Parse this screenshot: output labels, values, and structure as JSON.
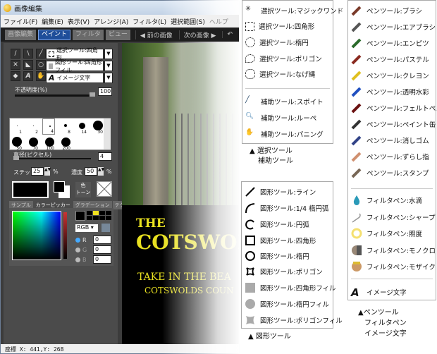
{
  "window": {
    "title": "画像編集"
  },
  "menu": [
    "ファイル(F)",
    "編集(E)",
    "表示(V)",
    "アレンジ(A)",
    "フィルタ(L)",
    "選択範囲(S)",
    "ヘルプ"
  ],
  "toolbar": {
    "tabs": [
      "画像編集",
      "ペイント",
      "フィルタ",
      "ビュー"
    ],
    "active": "ペイント",
    "prev": "◀ 前の画像",
    "next": "次の画像 ▶"
  },
  "panel": {
    "tool_selects": [
      "選択ツール:四角形",
      "図形ツール:四角形フィル",
      "イメージ文字"
    ],
    "opacity_label": "不透明度(%)",
    "opacity_value": "100",
    "opacity_fraction": 1.0,
    "brush_sizes": [
      "1",
      "2",
      "4",
      "8",
      "14",
      "30",
      "50",
      "70",
      "100",
      "200"
    ],
    "diameter_label": "直径(ピクセル)",
    "diameter_value": "4",
    "step_label": "ステップ",
    "step_value": "25",
    "density_label": "濃度",
    "density_value": "50",
    "pct": "%",
    "tone_button": "色\nトーン",
    "tabs": [
      "サンプル",
      "カラーピッカー",
      "グラデーション",
      "テクスチャ"
    ],
    "active_tab": "カラーピッカー",
    "color_mode": "RGB",
    "channels": [
      {
        "label": "R",
        "value": "0"
      },
      {
        "label": "G",
        "value": "0"
      },
      {
        "label": "B",
        "value": "0"
      }
    ]
  },
  "canvas": {
    "line1": "THE",
    "line2": "COTSWOLDS",
    "line3": "TAKE IN THE BEA",
    "line4": "COTSWOLDS COUN"
  },
  "status": "座標 X: 441,Y: 268",
  "select_menu": {
    "items": [
      "選択ツール:マジックワンド",
      "選択ツール:四角形",
      "選択ツール:楕円",
      "選択ツール:ポリゴン",
      "選択ツール:なげ縄",
      "補助ツール:スポイト",
      "補助ツール:ルーペ",
      "補助ツール:パニング"
    ],
    "caption1": "▲ 選択ツール",
    "caption2": "補助ツール"
  },
  "shape_menu": {
    "items": [
      "図形ツール:ライン",
      "図形ツール:1/4 楕円弧",
      "図形ツール:円弧",
      "図形ツール:四角形",
      "図形ツール:楕円",
      "図形ツール:ポリゴン",
      "図形ツール:四角形フィル",
      "図形ツール:楕円フィル",
      "図形ツール:ポリゴンフィル"
    ],
    "caption": "▲ 図形ツール"
  },
  "pen_menu": {
    "pens": [
      "ペンツール:ブラシ",
      "ペンツール:エアブラシ",
      "ペンツール:エンピツ",
      "ペンツール:パステル",
      "ペンツール:クレヨン",
      "ペンツール:透明水彩",
      "ペンツール:フェルトペン",
      "ペンツール:ペイント缶",
      "ペンツール:消しゴム",
      "ペンツール:ずらし指",
      "ペンツール:スタンプ"
    ],
    "filters": [
      "フィルタペン:水滴",
      "フィルタペン:シャープ",
      "フィルタペン:照度",
      "フィルタペン:モノクロ",
      "フィルタペン:モザイク"
    ],
    "text": "イメージ文字",
    "caption1": "▲ペンツール",
    "caption2": "フィルタペン",
    "caption3": "イメージ文字"
  },
  "colors": {
    "accent": "#1f4e9a",
    "sign_text": "#e8e020"
  }
}
